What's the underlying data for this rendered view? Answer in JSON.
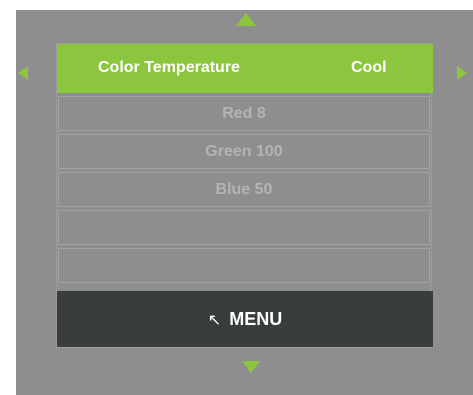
{
  "colors": {
    "accent": "#8cc63f",
    "background": "#8e8e8e",
    "menu_bar": "#3a3d3e"
  },
  "selected": {
    "label": "Color Temperature",
    "value": "Cool"
  },
  "items": [
    {
      "label": "Red 8"
    },
    {
      "label": "Green 100"
    },
    {
      "label": "Blue 50"
    },
    {
      "label": ""
    },
    {
      "label": ""
    }
  ],
  "menu_bar": {
    "icon": "return-arrow-icon",
    "icon_glyph": "↖",
    "label": "MENU"
  },
  "nav_icons": [
    "arrow-up-icon",
    "arrow-down-icon",
    "arrow-left-icon",
    "arrow-right-icon"
  ]
}
